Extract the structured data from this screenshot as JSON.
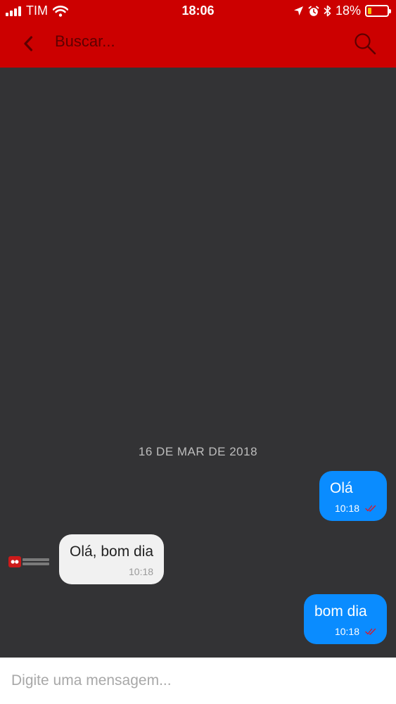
{
  "status_bar": {
    "carrier": "TIM",
    "time": "18:06",
    "battery": "18%",
    "battery_level": 0.18,
    "icons": [
      "signal-icon",
      "wifi-icon",
      "location-arrow-icon",
      "alarm-icon",
      "bluetooth-icon",
      "battery-icon"
    ]
  },
  "header": {
    "back_icon": "chevron-left-icon",
    "search_placeholder": "Buscar...",
    "search_icon": "search-icon",
    "color": "#cc0000"
  },
  "chat": {
    "date_separator": "16 DE MAR DE 2018",
    "messages": [
      {
        "direction": "outgoing",
        "text": "Olá",
        "time": "10:18",
        "status_icon": "double-check-icon"
      },
      {
        "direction": "incoming",
        "text": "Olá, bom dia",
        "time": "10:18"
      },
      {
        "direction": "outgoing",
        "text": "bom dia",
        "time": "10:18",
        "status_icon": "double-check-icon"
      }
    ],
    "outgoing_color": "#0a8cff",
    "incoming_color": "#f1f1f1",
    "background": "#333335"
  },
  "composer": {
    "placeholder": "Digite uma mensagem..."
  }
}
